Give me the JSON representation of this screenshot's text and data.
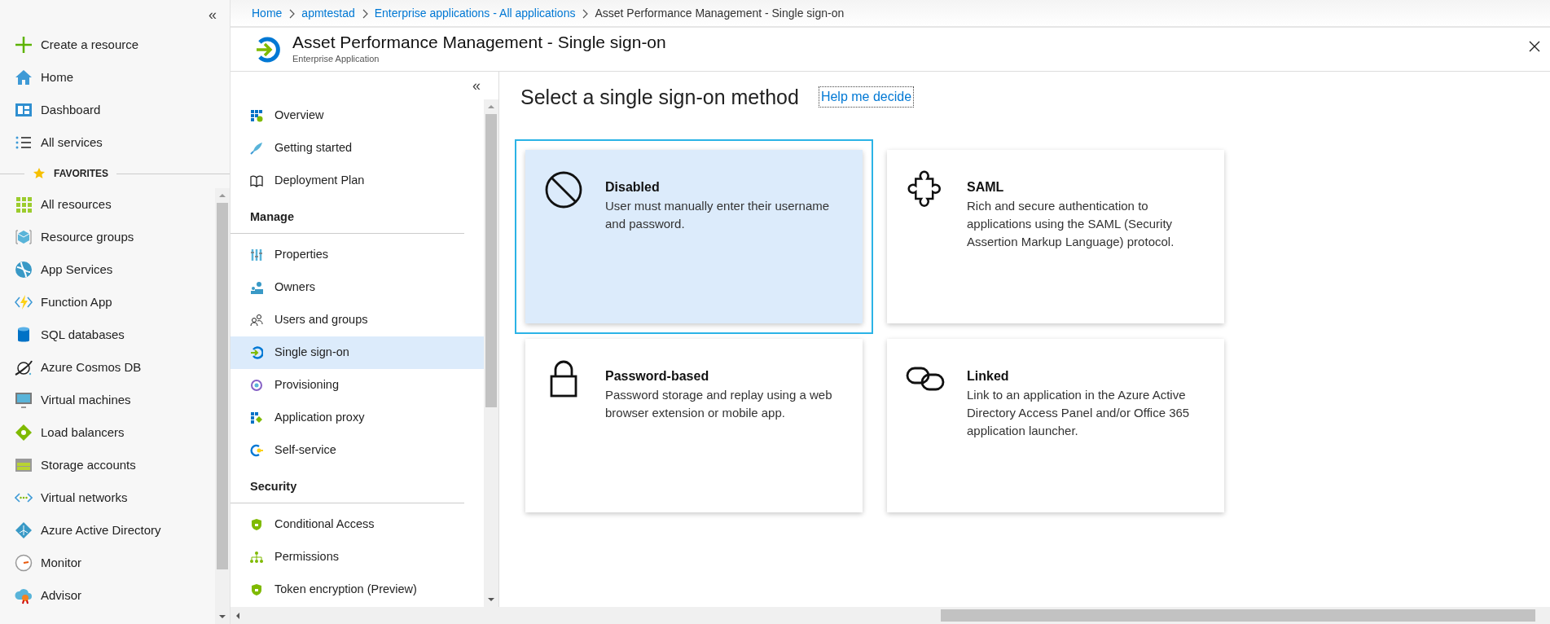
{
  "sidebar": {
    "collapse_glyph": "«",
    "items": [
      {
        "label": "Create a resource"
      },
      {
        "label": "Home"
      },
      {
        "label": "Dashboard"
      },
      {
        "label": "All services"
      }
    ],
    "favorites_label": "FAVORITES",
    "favorites": [
      {
        "label": "All resources"
      },
      {
        "label": "Resource groups"
      },
      {
        "label": "App Services"
      },
      {
        "label": "Function App"
      },
      {
        "label": "SQL databases"
      },
      {
        "label": "Azure Cosmos DB"
      },
      {
        "label": "Virtual machines"
      },
      {
        "label": "Load balancers"
      },
      {
        "label": "Storage accounts"
      },
      {
        "label": "Virtual networks"
      },
      {
        "label": "Azure Active Directory"
      },
      {
        "label": "Monitor"
      },
      {
        "label": "Advisor"
      }
    ]
  },
  "breadcrumb": [
    {
      "label": "Home",
      "current": false
    },
    {
      "label": "apmtestad",
      "current": false
    },
    {
      "label": "Enterprise applications - All applications",
      "current": false
    },
    {
      "label": "Asset Performance Management - Single sign-on",
      "current": true
    }
  ],
  "blade": {
    "title": "Asset Performance Management - Single sign-on",
    "subtitle": "Enterprise Application"
  },
  "menu": {
    "collapse_glyph": "«",
    "groups": [
      {
        "items": [
          {
            "label": "Overview",
            "selected": false
          },
          {
            "label": "Getting started",
            "selected": false
          },
          {
            "label": "Deployment Plan",
            "selected": false
          }
        ]
      },
      {
        "heading": "Manage",
        "items": [
          {
            "label": "Properties",
            "selected": false
          },
          {
            "label": "Owners",
            "selected": false
          },
          {
            "label": "Users and groups",
            "selected": false
          },
          {
            "label": "Single sign-on",
            "selected": true
          },
          {
            "label": "Provisioning",
            "selected": false
          },
          {
            "label": "Application proxy",
            "selected": false
          },
          {
            "label": "Self-service",
            "selected": false
          }
        ]
      },
      {
        "heading": "Security",
        "items": [
          {
            "label": "Conditional Access",
            "selected": false
          },
          {
            "label": "Permissions",
            "selected": false
          },
          {
            "label": "Token encryption (Preview)",
            "selected": false
          }
        ]
      }
    ]
  },
  "main": {
    "heading": "Select a single sign-on method",
    "help_link": "Help me decide",
    "methods": [
      {
        "title": "Disabled",
        "description": "User must manually enter their username and password.",
        "selected": true
      },
      {
        "title": "SAML",
        "description": "Rich and secure authentication to applications using the SAML (Security Assertion Markup Language) protocol.",
        "selected": false
      },
      {
        "title": "Password-based",
        "description": "Password storage and replay using a web browser extension or mobile app.",
        "selected": false
      },
      {
        "title": "Linked",
        "description": "Link to an application in the Azure Active Directory Access Panel and/or Office 365 application launcher.",
        "selected": false
      }
    ]
  }
}
